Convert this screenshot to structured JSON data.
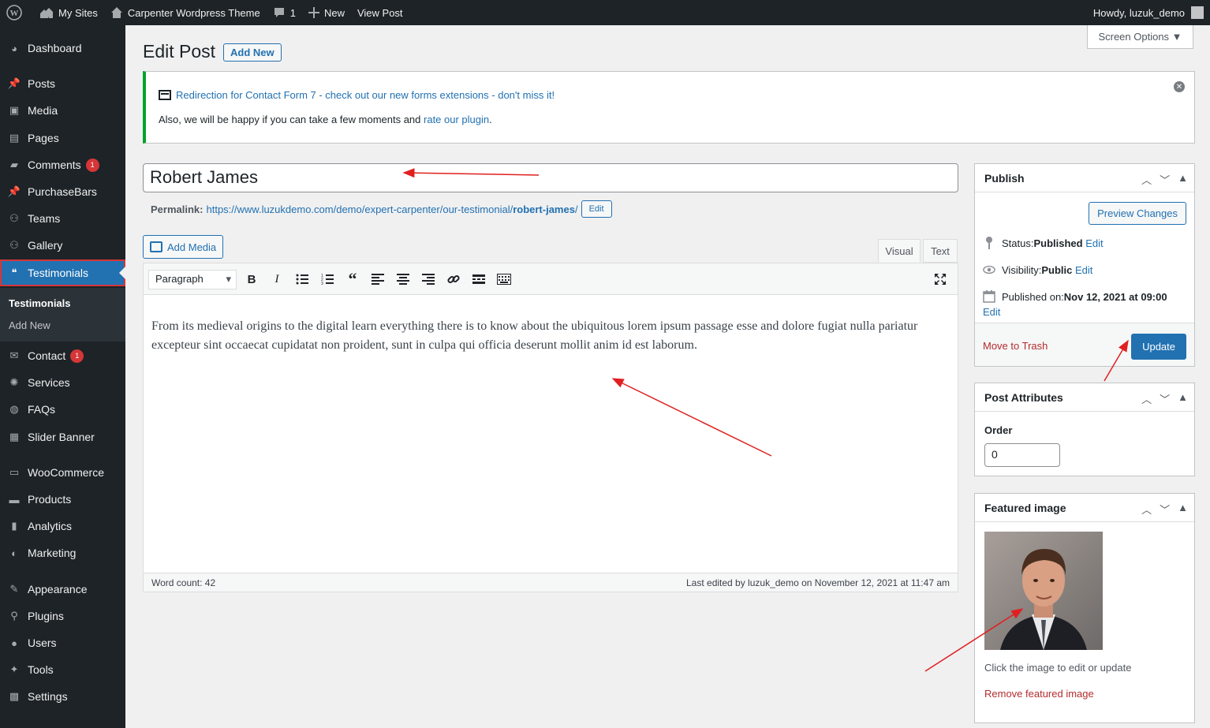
{
  "adminbar": {
    "my_sites": "My Sites",
    "site_name": "Carpenter Wordpress Theme",
    "comments_count": "1",
    "new_label": "New",
    "view_post": "View Post",
    "howdy": "Howdy, luzuk_demo"
  },
  "sidebar": {
    "items": [
      {
        "label": "Dashboard",
        "icon": "dashboard-icon"
      },
      {
        "label": "Posts",
        "icon": "pin-icon"
      },
      {
        "label": "Media",
        "icon": "media-icon"
      },
      {
        "label": "Pages",
        "icon": "pages-icon"
      },
      {
        "label": "Comments",
        "icon": "comment-icon",
        "badge": "1"
      },
      {
        "label": "PurchaseBars",
        "icon": "pin-icon"
      },
      {
        "label": "Teams",
        "icon": "groups-icon"
      },
      {
        "label": "Gallery",
        "icon": "groups-icon"
      },
      {
        "label": "Testimonials",
        "icon": "testimonial-icon"
      },
      {
        "label": "Contact",
        "icon": "email-icon",
        "badge": "1"
      },
      {
        "label": "Services",
        "icon": "services-icon"
      },
      {
        "label": "FAQs",
        "icon": "faq-icon"
      },
      {
        "label": "Slider Banner",
        "icon": "slides-icon"
      },
      {
        "label": "WooCommerce",
        "icon": "woo-icon"
      },
      {
        "label": "Products",
        "icon": "archive-icon"
      },
      {
        "label": "Analytics",
        "icon": "chart-icon"
      },
      {
        "label": "Marketing",
        "icon": "megaphone-icon"
      },
      {
        "label": "Appearance",
        "icon": "brush-icon"
      },
      {
        "label": "Plugins",
        "icon": "plugin-icon"
      },
      {
        "label": "Users",
        "icon": "users-icon"
      },
      {
        "label": "Tools",
        "icon": "wrench-icon"
      },
      {
        "label": "Settings",
        "icon": "settings-icon"
      }
    ],
    "submenu": {
      "current": "Testimonials",
      "add_new": "Add New"
    }
  },
  "header": {
    "screen_options": "Screen Options ▼",
    "title": "Edit Post",
    "add_new": "Add New"
  },
  "notice": {
    "link_text": "Redirection for Contact Form 7 - check out our new forms extensions - don't miss it!",
    "line2_prefix": "Also, we will be happy if you can take a few moments and ",
    "line2_link": "rate our plugin",
    "line2_suffix": "."
  },
  "post": {
    "title": "Robert James",
    "permalink_label": "Permalink:",
    "permalink_base": "https://www.luzukdemo.com/demo/expert-carpenter/our-testimonial/",
    "permalink_slug": "robert-james",
    "permalink_end": "/",
    "permalink_edit": "Edit"
  },
  "editor": {
    "add_media": "Add Media",
    "tab_visual": "Visual",
    "tab_text": "Text",
    "format": "Paragraph",
    "content": "From its medieval origins to the digital learn everything there is to know about the ubiquitous lorem ipsum passage esse and dolore fugiat nulla pariatur excepteur sint occaecat cupidatat non proident, sunt in culpa qui officia deserunt mollit anim id est laborum.",
    "word_count": "Word count: 42",
    "last_edited": "Last edited by luzuk_demo on November 12, 2021 at 11:47 am"
  },
  "publish": {
    "title": "Publish",
    "preview": "Preview Changes",
    "status_label": "Status: ",
    "status_value": "Published",
    "visibility_label": "Visibility: ",
    "visibility_value": "Public",
    "published_label": "Published on: ",
    "published_value": "Nov 12, 2021 at 09:00",
    "edit": "Edit",
    "trash": "Move to Trash",
    "update": "Update"
  },
  "attributes": {
    "title": "Post Attributes",
    "order_label": "Order",
    "order_value": "0"
  },
  "featured": {
    "title": "Featured image",
    "hint": "Click the image to edit or update",
    "remove": "Remove featured image"
  },
  "colors": {
    "accent": "#2271b1",
    "sidebar_bg": "#1d2327",
    "notice_border": "#00a32a",
    "badge": "#d63638",
    "annotation": "#e02020"
  }
}
